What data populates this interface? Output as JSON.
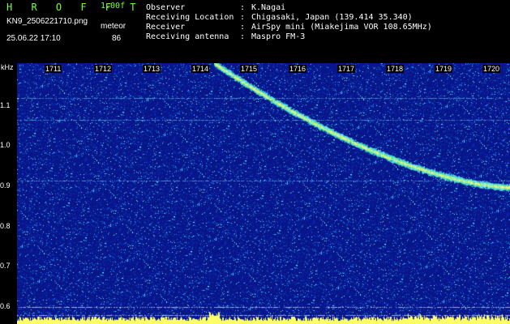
{
  "header": {
    "app_title": "H R O F F T",
    "version": "1.00f",
    "filename": "KN9_2506221710.png",
    "meteor_label": "meteor",
    "datetime": "25.06.22  17:10",
    "meteor_count": "86",
    "info": [
      {
        "key": "Observer",
        "colon": ":",
        "value": "K.Nagai"
      },
      {
        "key": "Receiving Location",
        "colon": ":",
        "value": "Chigasaki, Japan (139.414 35.340)"
      },
      {
        "key": "Receiver",
        "colon": ":",
        "value": "AirSpy mini (Miakejima VOR 108.65MHz)"
      },
      {
        "key": "Receiving antenna",
        "colon": ":",
        "value": "Maspro FM-3"
      }
    ]
  },
  "colors": {
    "title_green": "#7cfc3c",
    "text_white": "#ffffff",
    "signal_yellow": "#ffff66",
    "background_blue": "#0a1a8c"
  },
  "chart_data": {
    "type": "heatmap",
    "title": "",
    "xlabel": "",
    "ylabel": "kHz",
    "x_ticks": [
      "1711",
      "1712",
      "1713",
      "1714",
      "1715",
      "1716",
      "1717",
      "1718",
      "1719",
      "1720"
    ],
    "y_ticks": [
      "1.1",
      "1.0",
      "0.9",
      "0.8",
      "0.7",
      "0.6"
    ],
    "x_range_minutes": [
      1710,
      1720
    ],
    "y_range_khz": [
      0.58,
      1.18
    ],
    "features": {
      "doppler_trace": {
        "start_minute": 1714.0,
        "start_khz": 1.18,
        "end_minute": 1720.0,
        "end_khz": 0.895
      },
      "horizontal_lines_khz": [
        1.1,
        1.05,
        0.91,
        0.62,
        0.6
      ]
    }
  }
}
